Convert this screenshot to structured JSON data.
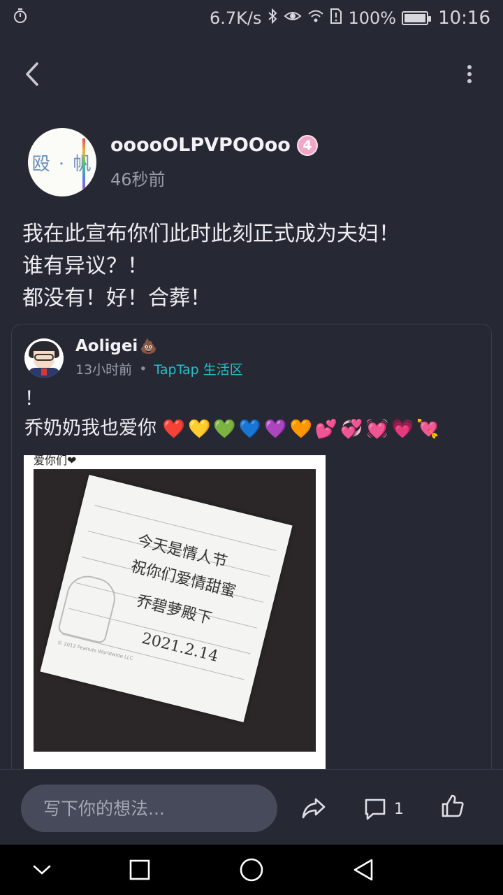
{
  "status_bar": {
    "speed": "6.7K/s",
    "battery": "100%",
    "battery_level": 1.0,
    "time": "10:16"
  },
  "author": {
    "name": "ooooOLPVPOOoo",
    "level": "4",
    "time": "46秒前"
  },
  "post": {
    "lines": [
      "我在此宣布你们此时此刻正式成为夫妇！",
      "谁有异议？！",
      "都没有！好！合葬！"
    ]
  },
  "quote": {
    "name": "Aoligei",
    "time": "13小时前",
    "separator": "•",
    "forum": "TapTap 生活区",
    "line1": "！",
    "line2": "乔奶奶我也爱你",
    "hearts": [
      {
        "glyph": "❤️",
        "color": "#d8263a"
      },
      {
        "glyph": "💛",
        "color": "#e6b21f"
      },
      {
        "glyph": "💚",
        "color": "#58a83a"
      },
      {
        "glyph": "💙",
        "color": "#2f86d8"
      },
      {
        "glyph": "💜",
        "color": "#7b2fb3"
      },
      {
        "glyph": "🧡",
        "color": "#e88417"
      },
      {
        "glyph": "💕",
        "color": "#d8263a"
      },
      {
        "glyph": "💞",
        "color": "#d8263a"
      },
      {
        "glyph": "💓",
        "color": "#d8263a"
      },
      {
        "glyph": "💗",
        "color": "#e86d8c"
      },
      {
        "glyph": "💘",
        "color": "#d8263a"
      }
    ],
    "photo": {
      "caption": "爱你们❤",
      "note_line1": "今天是情人节",
      "note_line2": "祝你们爱情甜蜜",
      "note_line3": "乔碧萝殿下",
      "note_date": "2021.2.14",
      "copyright": "© 2012 Peanuts Worldwide LLC"
    }
  },
  "bottom": {
    "placeholder": "写下你的想法...",
    "comment_count": "1"
  }
}
